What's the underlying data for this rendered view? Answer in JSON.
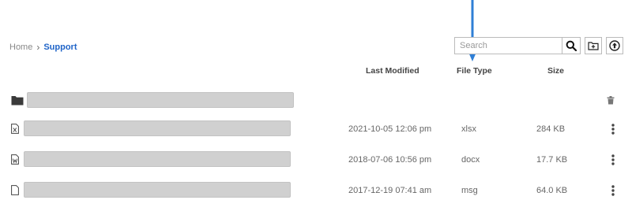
{
  "breadcrumb": {
    "home": "Home",
    "separator": "›",
    "current": "Support"
  },
  "search": {
    "placeholder": "Search",
    "value": ""
  },
  "columns": {
    "last_modified": "Last Modified",
    "file_type": "File Type",
    "size": "Size"
  },
  "rows": [
    {
      "kind": "folder",
      "modified": "",
      "type": "",
      "size": ""
    },
    {
      "kind": "file-xlsx",
      "modified": "2021-10-05 12:06 pm",
      "type": "xlsx",
      "size": "284 KB"
    },
    {
      "kind": "file-docx",
      "modified": "2018-07-06 10:56 pm",
      "type": "docx",
      "size": "17.7 KB"
    },
    {
      "kind": "file-msg",
      "modified": "2017-12-19 07:41 am",
      "type": "msg",
      "size": "64.0 KB"
    }
  ],
  "icons": {
    "search": "search-icon",
    "new_folder": "new-folder-icon",
    "upload": "upload-icon",
    "folder": "folder-icon",
    "file": "file-icon",
    "trash": "trash-icon",
    "more": "kebab-menu-icon"
  },
  "colors": {
    "accent": "#1f64c8",
    "annotation_arrow": "#2f7fd6",
    "placeholder_bar": "#d0d0d0"
  }
}
